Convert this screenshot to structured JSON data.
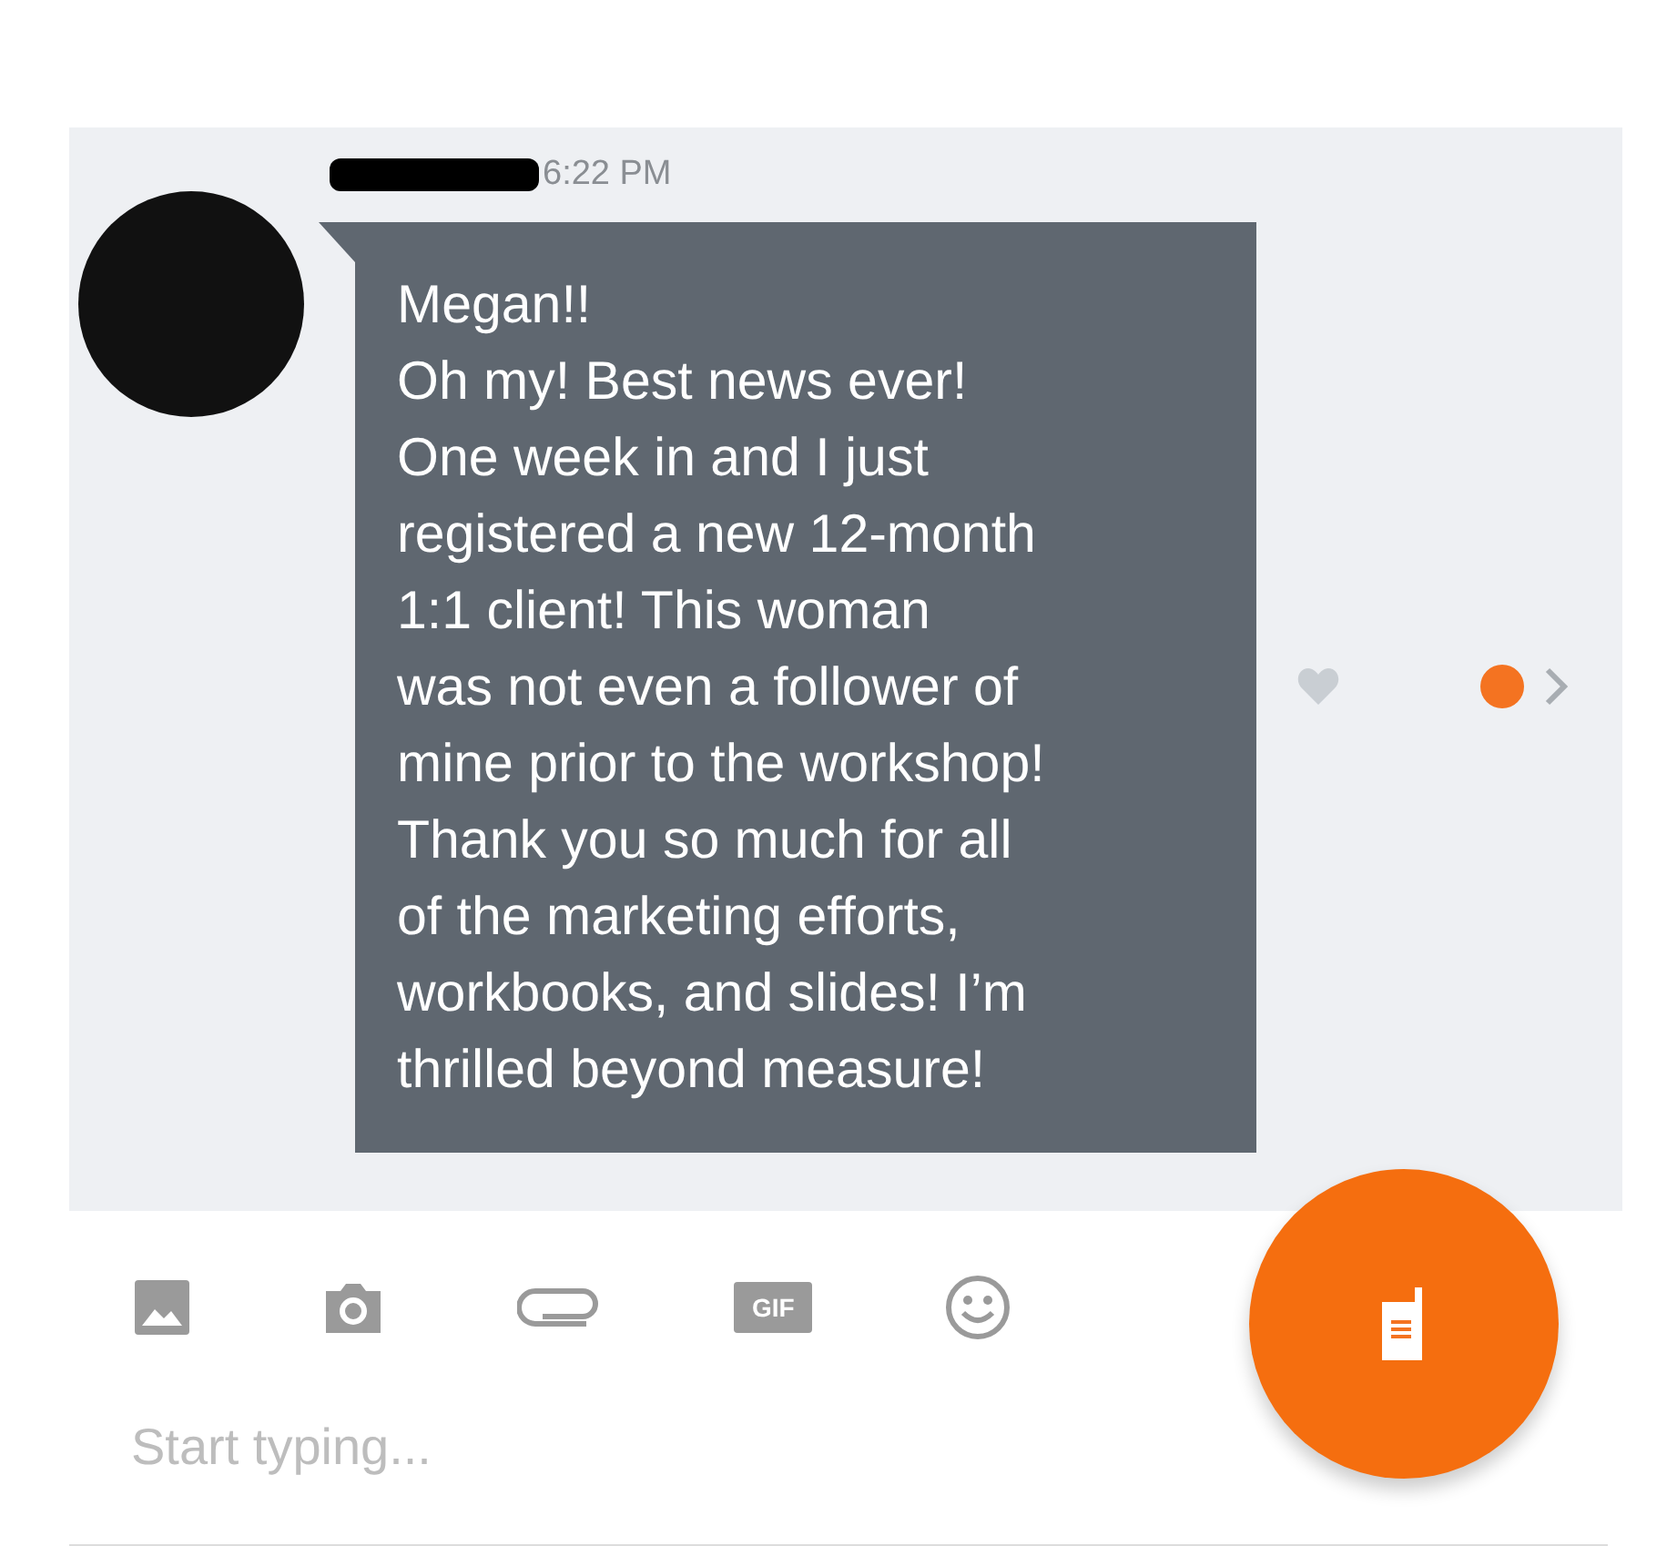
{
  "message": {
    "time": "6:22 PM",
    "lines": [
      "Megan!!",
      "Oh my! Best news ever!",
      "One week in and I just",
      "registered a new 12-month",
      "1:1 client! This woman",
      "was not even a follower of",
      "mine prior to the workshop!",
      "Thank you so much for all",
      "of the marketing efforts,",
      "workbooks, and slides! I’m",
      "thrilled beyond measure!"
    ]
  },
  "toolbar": {
    "gif_label": "GIF"
  },
  "composer": {
    "placeholder": "Start typing..."
  }
}
